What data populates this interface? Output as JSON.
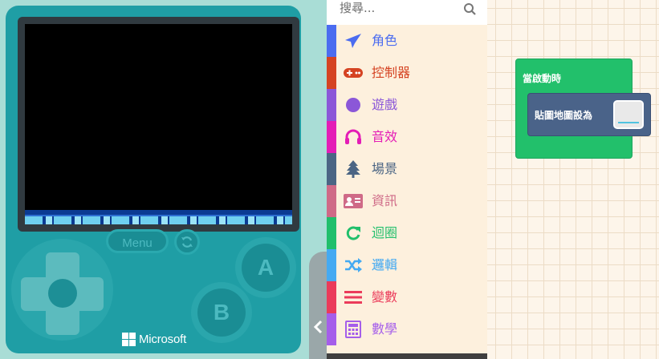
{
  "simulator": {
    "menu_label": "Menu",
    "a_label": "A",
    "b_label": "B",
    "brand_name": "Microsoft"
  },
  "search": {
    "placeholder": "搜尋..."
  },
  "toolbox": {
    "categories": [
      {
        "label": "角色",
        "color": "#4b6cf0",
        "icon": "paper-plane-icon"
      },
      {
        "label": "控制器",
        "color": "#d54322",
        "icon": "gamepad-icon"
      },
      {
        "label": "遊戲",
        "color": "#8b57d8",
        "icon": "circle-icon"
      },
      {
        "label": "音效",
        "color": "#e41db6",
        "icon": "headphones-icon"
      },
      {
        "label": "場景",
        "color": "#4b6584",
        "icon": "tree-icon"
      },
      {
        "label": "資訊",
        "color": "#cf6a87",
        "icon": "id-card-icon"
      },
      {
        "label": "迴圈",
        "color": "#20bf6b",
        "icon": "refresh-icon"
      },
      {
        "label": "邏輯",
        "color": "#45aaf2",
        "icon": "shuffle-icon"
      },
      {
        "label": "變數",
        "color": "#eb3b5a",
        "icon": "list-icon"
      },
      {
        "label": "數學",
        "color": "#a55eea",
        "icon": "calculator-icon"
      }
    ]
  },
  "workspace": {
    "event_label": "當啟動時",
    "statement_label": "貼圖地圖設為"
  }
}
